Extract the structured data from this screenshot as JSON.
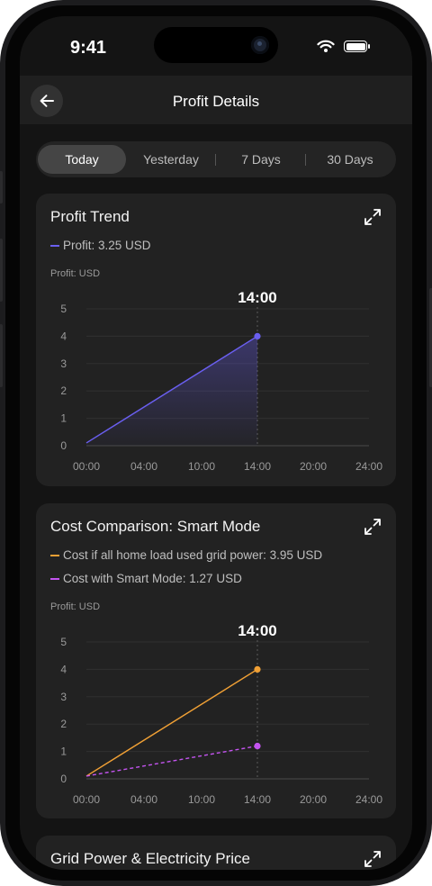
{
  "status": {
    "time": "9:41"
  },
  "header": {
    "title": "Profit Details"
  },
  "tabs": [
    {
      "label": "Today",
      "active": true
    },
    {
      "label": "Yesterday",
      "active": false
    },
    {
      "label": "7 Days",
      "active": false
    },
    {
      "label": "30 Days",
      "active": false
    }
  ],
  "profit_card": {
    "title": "Profit Trend",
    "legend": "Profit: 3.25 USD",
    "unit_label": "Profit: USD",
    "marker_label": "14:00"
  },
  "cost_card": {
    "title": "Cost Comparison: Smart Mode",
    "legend_grid": "Cost if all home load used grid power: 3.95 USD",
    "legend_smart": "Cost with Smart Mode: 1.27 USD",
    "unit_label": "Profit: USD",
    "marker_label": "14:00"
  },
  "grid_card": {
    "title": "Grid Power & Electricity Price"
  },
  "colors": {
    "profit": "#6a5ff0",
    "grid": "#f0a035",
    "smart": "#c454f0",
    "accent": "#ffffff"
  },
  "icons": [
    "back-arrow-icon",
    "expand-icon",
    "wifi-icon",
    "battery-icon",
    "camera-icon"
  ],
  "chart_data": [
    {
      "type": "area",
      "x_ticks": [
        "00:00",
        "04:00",
        "10:00",
        "14:00",
        "20:00",
        "24:00"
      ],
      "y_ticks": [
        "0",
        "1",
        "2",
        "3",
        "4",
        "5"
      ],
      "ylim": [
        0,
        5
      ],
      "series": [
        {
          "name": "Profit",
          "points": [
            {
              "x": "00:00",
              "y": 0.1
            },
            {
              "x": "14:00",
              "y": 4
            }
          ]
        }
      ]
    },
    {
      "type": "line",
      "x_ticks": [
        "00:00",
        "04:00",
        "10:00",
        "14:00",
        "20:00",
        "24:00"
      ],
      "y_ticks": [
        "0",
        "1",
        "2",
        "3",
        "4",
        "5"
      ],
      "ylim": [
        0,
        5
      ],
      "series": [
        {
          "name": "Cost if all home load used grid power",
          "points": [
            {
              "x": "00:00",
              "y": 0.1
            },
            {
              "x": "14:00",
              "y": 4
            }
          ]
        },
        {
          "name": "Cost with Smart Mode",
          "points": [
            {
              "x": "00:00",
              "y": 0.1
            },
            {
              "x": "14:00",
              "y": 1.2
            }
          ]
        }
      ]
    }
  ]
}
